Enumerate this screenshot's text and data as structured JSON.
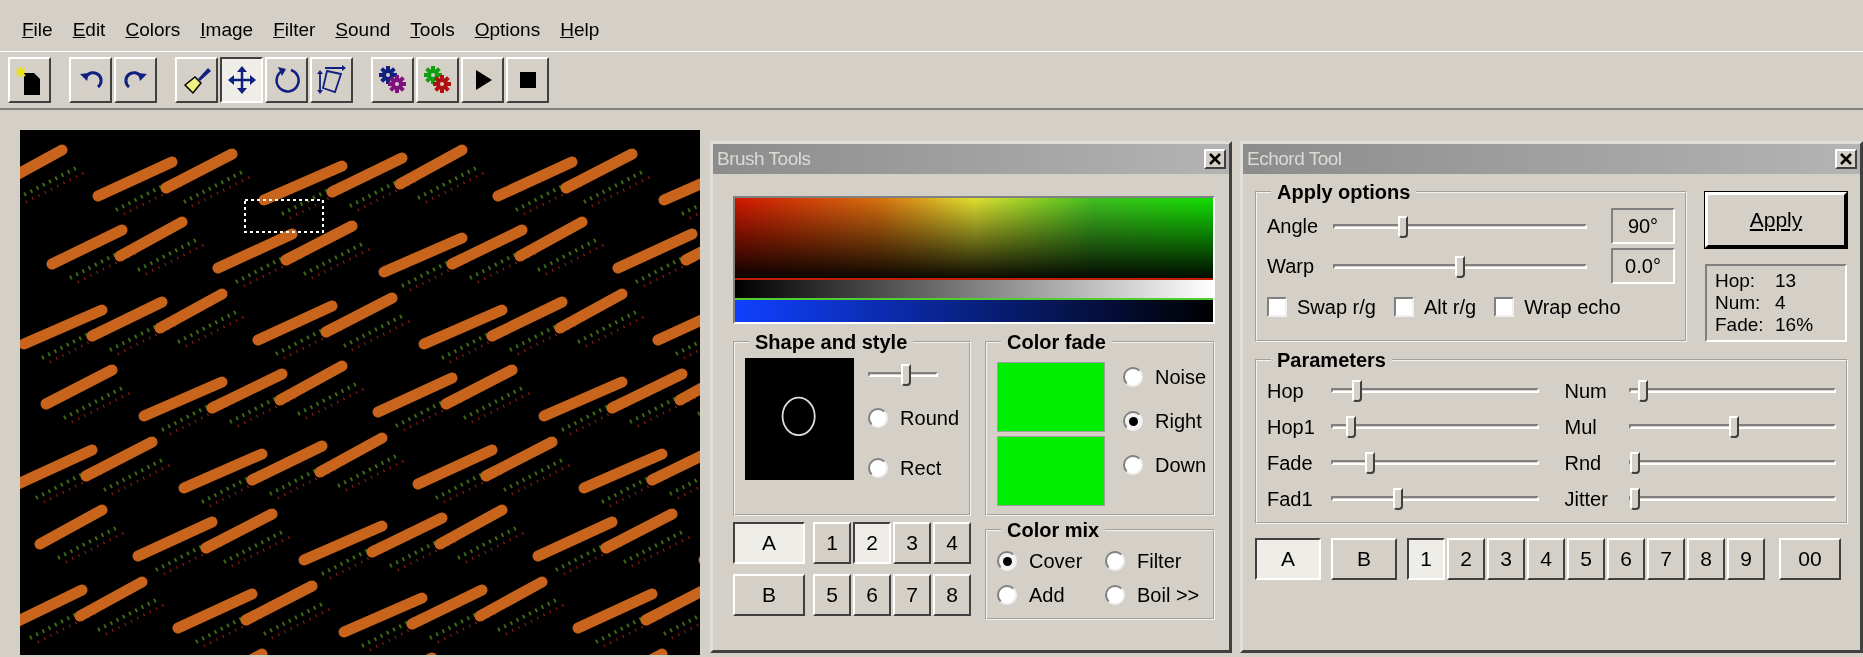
{
  "menu": [
    {
      "label": "File"
    },
    {
      "label": "Edit"
    },
    {
      "label": "Colors"
    },
    {
      "label": "Image"
    },
    {
      "label": "Filter"
    },
    {
      "label": "Sound"
    },
    {
      "label": "Tools"
    },
    {
      "label": "Options"
    },
    {
      "label": "Help"
    }
  ],
  "toolbar": [
    [
      {
        "kind": "new",
        "selected": false
      }
    ],
    [
      {
        "kind": "undo",
        "selected": false
      },
      {
        "kind": "redo",
        "selected": false
      }
    ],
    [
      {
        "kind": "brush",
        "selected": false
      },
      {
        "kind": "move",
        "selected": true
      },
      {
        "kind": "rotate",
        "selected": false
      },
      {
        "kind": "transform",
        "selected": false
      }
    ],
    [
      {
        "kind": "gears-blue",
        "selected": false
      },
      {
        "kind": "gears-green",
        "selected": false
      },
      {
        "kind": "play",
        "selected": false
      },
      {
        "kind": "stop",
        "selected": false
      }
    ]
  ],
  "brush_tools": {
    "title": "Brush Tools",
    "shape_and_style": {
      "title": "Shape and style",
      "size": {
        "level": 0.55
      },
      "options": [
        {
          "label": "Round",
          "selected": false
        },
        {
          "label": "Rect",
          "selected": false
        }
      ]
    },
    "color_fade": {
      "title": "Color fade",
      "options": [
        {
          "label": "Noise",
          "selected": false
        },
        {
          "label": "Right",
          "selected": true
        },
        {
          "label": "Down",
          "selected": false
        }
      ]
    },
    "color_mix": {
      "title": "Color mix",
      "options": [
        {
          "label": "Cover",
          "selected": true
        },
        {
          "label": "Filter",
          "selected": false
        },
        {
          "label": "Add",
          "selected": false
        },
        {
          "label": "Boil >>",
          "selected": false
        }
      ]
    },
    "banks": [
      {
        "label": "A",
        "selected": true
      },
      {
        "label": "B",
        "selected": false
      }
    ],
    "slots": [
      {
        "label": "1",
        "selected": false
      },
      {
        "label": "2",
        "selected": true
      },
      {
        "label": "3",
        "selected": false
      },
      {
        "label": "4",
        "selected": false
      },
      {
        "label": "5",
        "selected": false
      },
      {
        "label": "6",
        "selected": false
      },
      {
        "label": "7",
        "selected": false
      },
      {
        "label": "8",
        "selected": false
      }
    ]
  },
  "echord_tool": {
    "title": "Echord Tool",
    "apply_options": {
      "title": "Apply options",
      "sliders": [
        {
          "label": "Angle",
          "level": 0.27,
          "reading": "90°"
        },
        {
          "label": "Warp",
          "level": 0.5,
          "reading": "0.0°"
        }
      ],
      "checkboxes": [
        {
          "label": "Swap r/g",
          "checked": false
        },
        {
          "label": "Alt r/g",
          "checked": false
        },
        {
          "label": "Wrap echo",
          "checked": false
        }
      ]
    },
    "apply_button": "Apply",
    "stats": [
      {
        "label": "Hop:",
        "value": "13"
      },
      {
        "label": "Num:",
        "value": "4"
      },
      {
        "label": "Fade:",
        "value": "16%"
      }
    ],
    "parameters": {
      "title": "Parameters",
      "sliders": [
        {
          "label": "Hop",
          "level": 0.12
        },
        {
          "label": "Num",
          "level": 0.06
        },
        {
          "label": "Hop1",
          "level": 0.09
        },
        {
          "label": "Mul",
          "level": 0.51
        },
        {
          "label": "Fade",
          "level": 0.18
        },
        {
          "label": "Rnd",
          "level": 0.02
        },
        {
          "label": "Fad1",
          "level": 0.32
        },
        {
          "label": "Jitter",
          "level": 0.02
        }
      ]
    },
    "banks": [
      {
        "label": "A",
        "selected": true
      },
      {
        "label": "B",
        "selected": false
      }
    ],
    "slots": [
      {
        "label": "1",
        "selected": true
      },
      {
        "label": "2",
        "selected": false
      },
      {
        "label": "3",
        "selected": false
      },
      {
        "label": "4",
        "selected": false
      },
      {
        "label": "5",
        "selected": false
      },
      {
        "label": "6",
        "selected": false
      },
      {
        "label": "7",
        "selected": false
      },
      {
        "label": "8",
        "selected": false
      },
      {
        "label": "9",
        "selected": false
      }
    ],
    "extra_button": "00"
  }
}
